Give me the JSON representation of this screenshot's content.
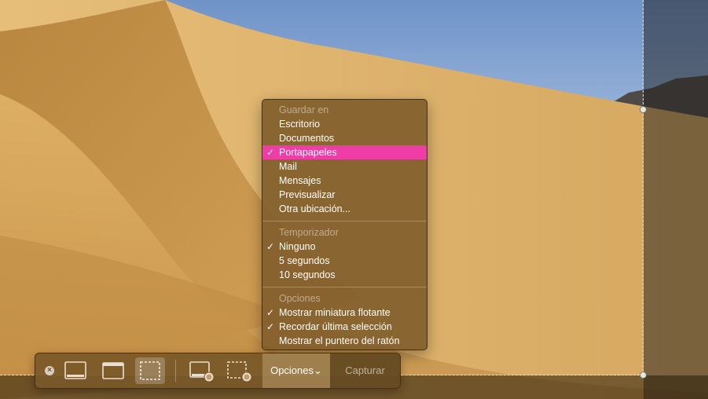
{
  "colors": {
    "highlight": "#ee3ea6",
    "menu_bg": "#825f2d",
    "toolbar_bg": "#78582a"
  },
  "menu": {
    "save_section": {
      "header": "Guardar en",
      "items": [
        {
          "label": "Escritorio",
          "checked": false
        },
        {
          "label": "Documentos",
          "checked": false
        },
        {
          "label": "Portapapeles",
          "checked": true,
          "highlighted": true
        },
        {
          "label": "Mail",
          "checked": false
        },
        {
          "label": "Mensajes",
          "checked": false
        },
        {
          "label": "Previsualizar",
          "checked": false
        },
        {
          "label": "Otra ubicación...",
          "checked": false
        }
      ]
    },
    "timer_section": {
      "header": "Temporizador",
      "items": [
        {
          "label": "Ninguno",
          "checked": true
        },
        {
          "label": "5 segundos",
          "checked": false
        },
        {
          "label": "10 segundos",
          "checked": false
        }
      ]
    },
    "options_section": {
      "header": "Opciones",
      "items": [
        {
          "label": "Mostrar miniatura flotante",
          "checked": true
        },
        {
          "label": "Recordar última selección",
          "checked": true
        },
        {
          "label": "Mostrar el puntero del ratón",
          "checked": false
        }
      ]
    },
    "check_glyph": "✓"
  },
  "toolbar": {
    "close_icon": "close-icon",
    "tools": [
      {
        "icon": "capture-entire-screen-icon",
        "active": false
      },
      {
        "icon": "capture-window-icon",
        "active": false
      },
      {
        "icon": "capture-selection-icon",
        "active": true
      },
      {
        "icon": "record-entire-screen-icon",
        "active": false
      },
      {
        "icon": "record-selection-icon",
        "active": false
      }
    ],
    "options_label": "Opciones",
    "options_chevron": "⌄",
    "capture_label": "Capturar"
  }
}
